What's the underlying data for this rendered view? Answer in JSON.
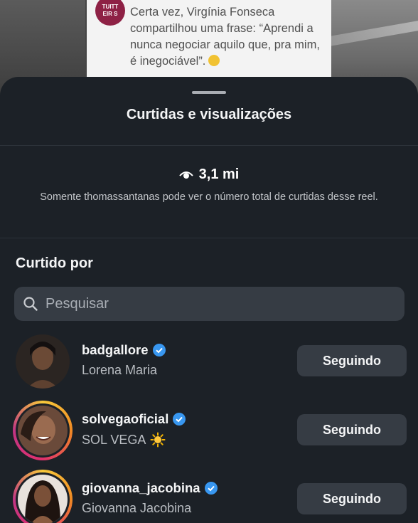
{
  "background_tweet": {
    "avatar_text": "TUITT\nEIR S",
    "text": "Certa vez, Virgínia Fonseca compartilhou uma frase: “Aprendi a nunca negociar aquilo que, pra mim, é inegociável”."
  },
  "sheet": {
    "title": "Curtidas e visualizações",
    "views_icon": "eye-icon",
    "views_count": "3,1 mi",
    "views_note": "Somente thomassantanas pode ver o número total de curtidas desse reel.",
    "liked_by_label": "Curtido por",
    "search": {
      "placeholder": "Pesquisar",
      "value": ""
    },
    "users": [
      {
        "username": "badgallore",
        "verified": true,
        "full_name": "Lorena Maria",
        "full_name_icon": "",
        "has_story_ring": false,
        "button_label": "Seguindo",
        "avatar_color": "#2b2522"
      },
      {
        "username": "solvegaoficial",
        "verified": true,
        "full_name": "SOL VEGA",
        "full_name_icon": "sun-icon",
        "has_story_ring": true,
        "button_label": "Seguindo",
        "avatar_color": "#6a4a3a"
      },
      {
        "username": "giovanna_jacobina",
        "verified": true,
        "full_name": "Giovanna Jacobina",
        "full_name_icon": "",
        "has_story_ring": true,
        "button_label": "Seguindo",
        "avatar_color": "#5a4030"
      }
    ]
  },
  "colors": {
    "sheet_bg": "#1c2127",
    "button_bg": "#363c44",
    "verified": "#3897f0"
  }
}
